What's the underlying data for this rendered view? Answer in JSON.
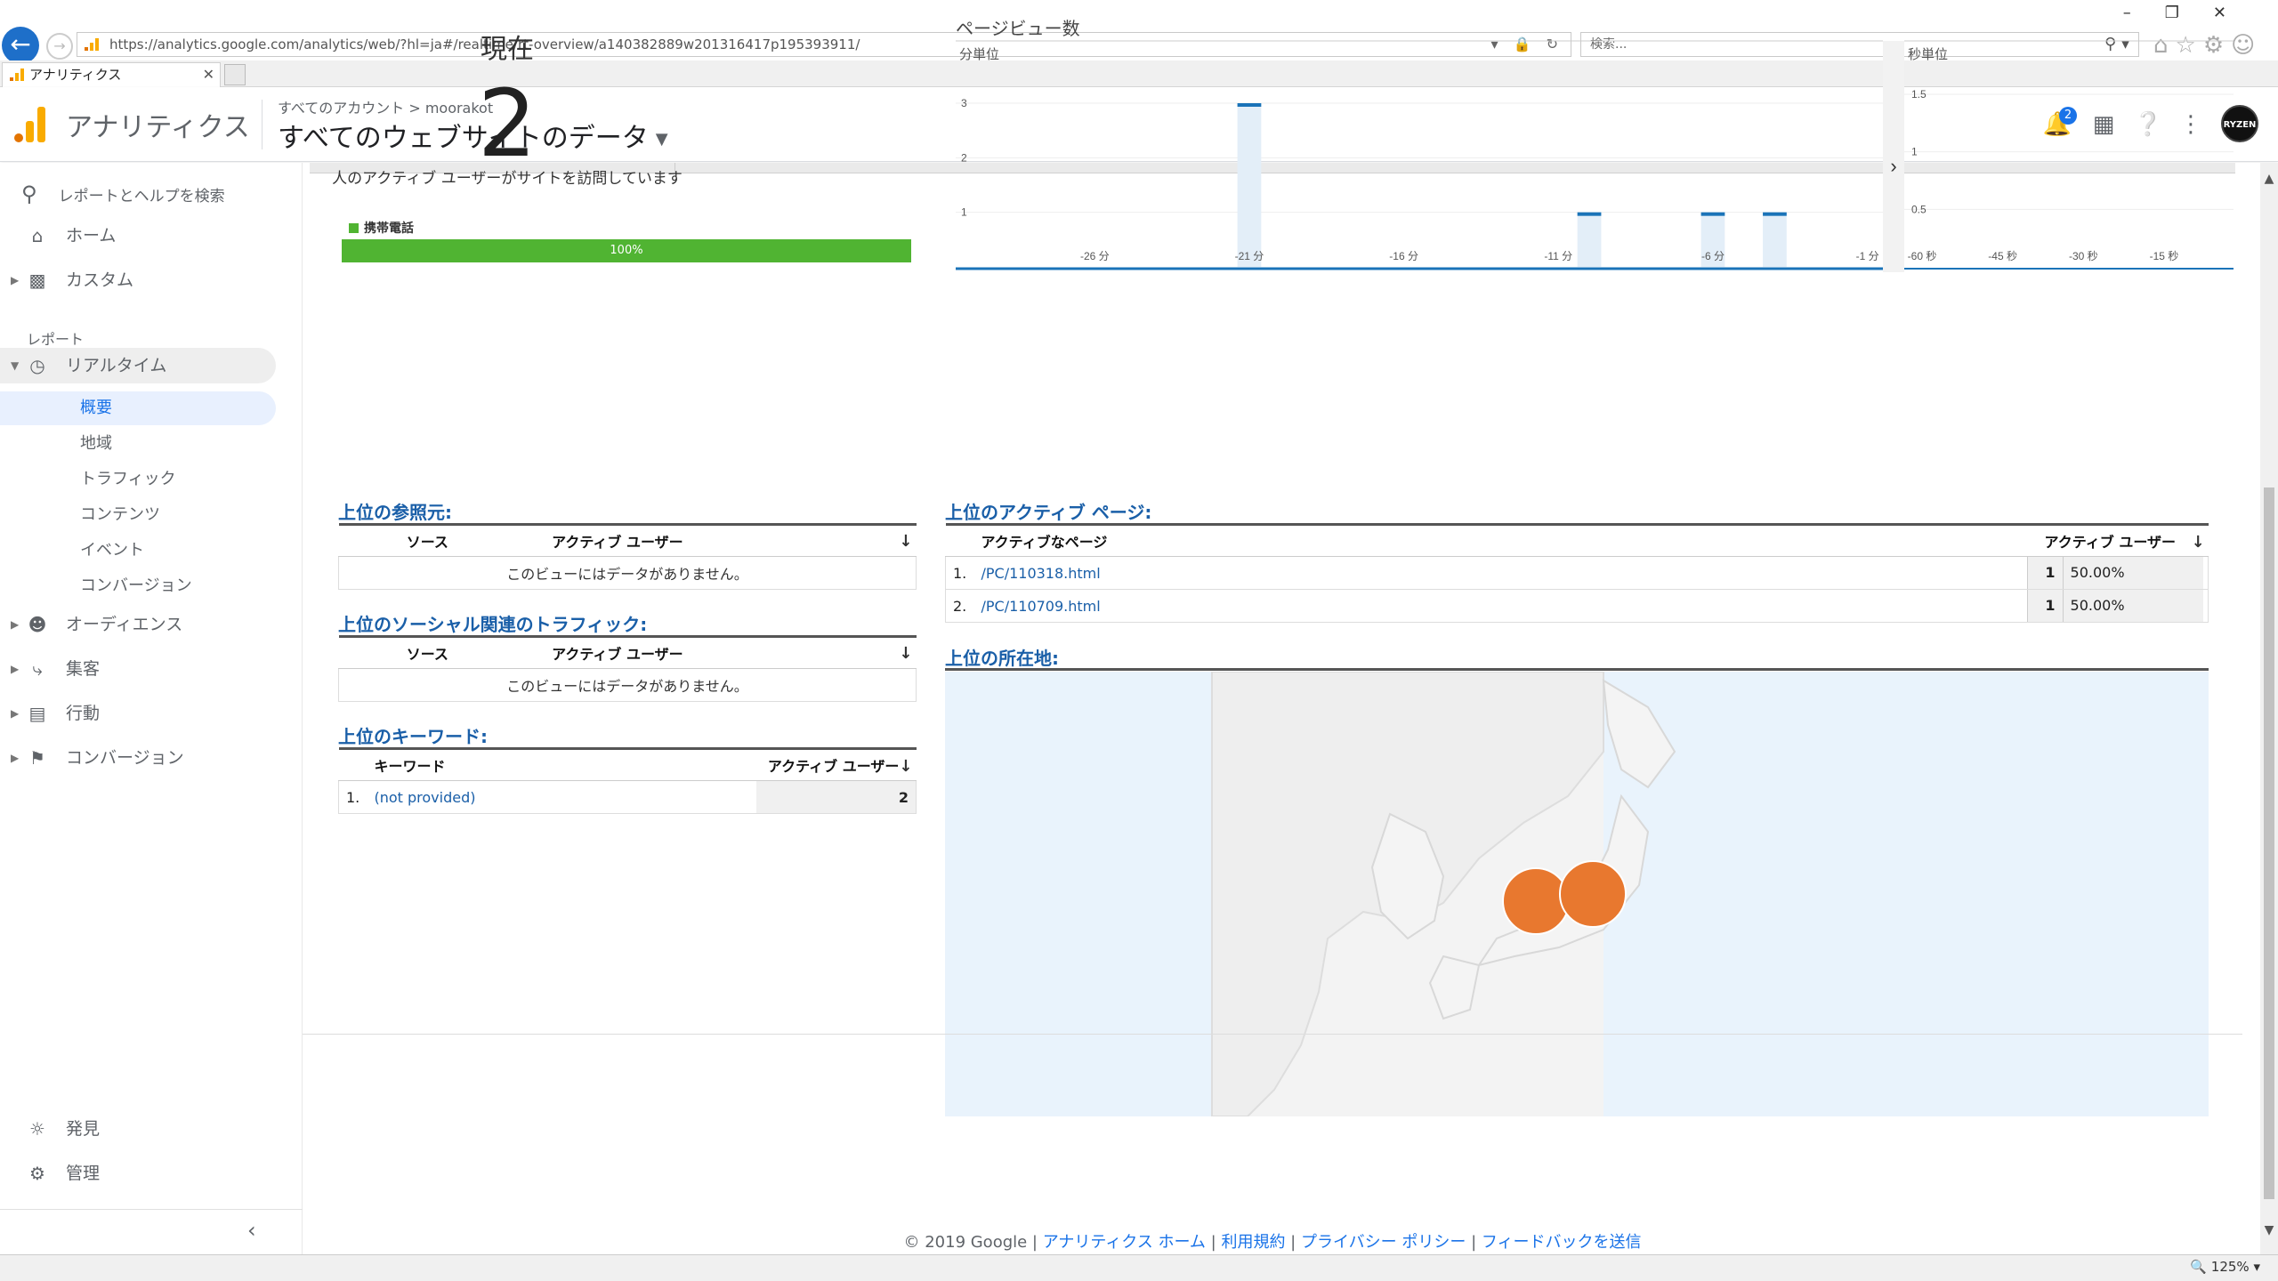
{
  "browser": {
    "url": "https://analytics.google.com/analytics/web/?hl=ja#/realtime/rt-overview/a140382889w201316417p195393911/",
    "search_placeholder": "検索...",
    "tab_title": "アナリティクス",
    "zoom": "125%"
  },
  "header": {
    "app_name": "アナリティクス",
    "account_crumb": "すべてのアカウント > moorakot",
    "view_name": "すべてのウェブサイトのデータ",
    "notification_count": "2",
    "avatar_text": "RYZEN"
  },
  "sidebar": {
    "search_label": "レポートとヘルプを検索",
    "home": "ホーム",
    "custom": "カスタム",
    "reports_heading": "レポート",
    "realtime": "リアルタイム",
    "realtime_sub": [
      "概要",
      "地域",
      "トラフィック",
      "コンテンツ",
      "イベント",
      "コンバージョン"
    ],
    "audience": "オーディエンス",
    "acquisition": "集客",
    "behavior": "行動",
    "conversions": "コンバージョン",
    "discover": "発見",
    "admin": "管理"
  },
  "overview": {
    "now_label": "現在",
    "active_users": "2",
    "active_desc": "人のアクティブ ユーザーがサイトを訪問しています",
    "device_label": "携帯電話",
    "device_percent": "100%",
    "device_fraction": 1.0,
    "device_color": "#50b432"
  },
  "chart_data": [
    {
      "type": "bar",
      "title": "ページビュー数",
      "panel_label": "分単位",
      "x_tick_labels": [
        "-26 分",
        "-21 分",
        "-16 分",
        "-11 分",
        "-6 分",
        "-1 分"
      ],
      "x": [
        -30,
        -29,
        -28,
        -27,
        -26,
        -25,
        -24,
        -23,
        -22,
        -21,
        -20,
        -19,
        -18,
        -17,
        -16,
        -15,
        -14,
        -13,
        -12,
        -11,
        -10,
        -9,
        -8,
        -7,
        -6,
        -5,
        -4,
        -3,
        -2,
        -1
      ],
      "values": [
        0,
        0,
        0,
        0,
        0,
        0,
        0,
        0,
        0,
        3,
        0,
        0,
        0,
        0,
        0,
        0,
        0,
        0,
        0,
        0,
        1,
        0,
        0,
        0,
        1,
        0,
        1,
        0,
        0,
        0
      ],
      "y_ticks": [
        "1",
        "2",
        "3"
      ],
      "ylim": [
        0,
        3
      ],
      "grid": true,
      "bar_color": "#e3eef8",
      "bar_top_color": "#1a73b8"
    },
    {
      "type": "bar",
      "panel_label": "秒単位",
      "x_tick_labels": [
        "-60 秒",
        "-45 秒",
        "-30 秒",
        "-15 秒"
      ],
      "values": [],
      "y_ticks": [
        "0.5",
        "1",
        "1.5"
      ],
      "ylim": [
        0,
        1.5
      ],
      "grid": true
    }
  ],
  "referrals": {
    "title": "上位の参照元:",
    "col_source": "ソース",
    "col_users": "アクティブ ユーザー",
    "empty": "このビューにはデータがありません。"
  },
  "social": {
    "title": "上位のソーシャル関連のトラフィック:",
    "col_source": "ソース",
    "col_users": "アクティブ ユーザー",
    "empty": "このビューにはデータがありません。"
  },
  "keywords": {
    "title": "上位のキーワード:",
    "col_keyword": "キーワード",
    "col_users": "アクティブ ユーザー",
    "rows": [
      {
        "rank": "1.",
        "keyword": "(not provided)",
        "users": "2"
      }
    ]
  },
  "active_pages": {
    "title": "上位のアクティブ ページ:",
    "col_page": "アクティブなページ",
    "col_users": "アクティブ ユーザー",
    "rows": [
      {
        "rank": "1.",
        "page": "/PC/110318.html",
        "users": "1",
        "pct": "50.00%"
      },
      {
        "rank": "2.",
        "page": "/PC/110709.html",
        "users": "1",
        "pct": "50.00%"
      }
    ]
  },
  "locations": {
    "title": "上位の所在地:",
    "marker_color": "#e8782f"
  },
  "footer": {
    "copyright": "© 2019 Google |",
    "links": [
      "アナリティクス ホーム",
      "利用規約",
      "プライバシー ポリシー",
      "フィードバックを送信"
    ]
  }
}
